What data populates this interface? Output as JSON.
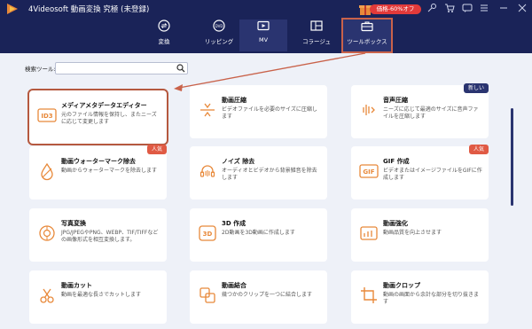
{
  "window": {
    "title": "4Videosoft 動画変換 究極 (未登録)",
    "promo_label": "価格-60%オフ"
  },
  "nav": {
    "tabs": [
      {
        "label": "変換",
        "icon": "convert-icon"
      },
      {
        "label": "リッピング",
        "icon": "dvd-icon"
      },
      {
        "label": "MV",
        "icon": "mv-icon"
      },
      {
        "label": "コラージュ",
        "icon": "collage-icon"
      },
      {
        "label": "ツールボックス",
        "icon": "toolbox-icon"
      }
    ],
    "active_index": 2,
    "highlight_index": 4
  },
  "search": {
    "label": "検索ツール:",
    "placeholder": ""
  },
  "tools": [
    {
      "title": "メディアメタデータエディター",
      "desc": "元のファイル情報を保持し、またニーズに応じて変更します",
      "icon": "id3-icon",
      "badge": ""
    },
    {
      "title": "動画圧縮",
      "desc": "ビデオファイルを必要のサイズに圧縮します",
      "icon": "compress-icon",
      "badge": ""
    },
    {
      "title": "音声圧縮",
      "desc": "ニーズに応じて最適のサイズに音声ファイルを圧縮します",
      "icon": "audio-compress-icon",
      "badge": "新しい"
    },
    {
      "title": "動画ウォーターマーク除去",
      "desc": "動画からウォーターマークを除去します",
      "icon": "watermark-remove-icon",
      "badge": "人気"
    },
    {
      "title": "ノイズ 除去",
      "desc": "オーディオとビデオから背景雑音を除去します",
      "icon": "noise-remove-icon",
      "badge": ""
    },
    {
      "title": "GIF 作成",
      "desc": "ビデオまたはイメージファイルをGIFに作成します",
      "icon": "gif-icon",
      "badge": "人気"
    },
    {
      "title": "写真変換",
      "desc": "JPG/JPEGやPNG、WEBP、TIF/TIFFなどの画像形式を相互変換します。",
      "icon": "photo-convert-icon",
      "badge": ""
    },
    {
      "title": "3D 作成",
      "desc": "2D動画を3D動画に作成します",
      "icon": "3d-icon",
      "badge": ""
    },
    {
      "title": "動画強化",
      "desc": "動画品質を向上させます",
      "icon": "enhance-icon",
      "badge": ""
    },
    {
      "title": "動画カット",
      "desc": "動画を最適な長さでカットします",
      "icon": "cut-icon",
      "badge": ""
    },
    {
      "title": "動画結合",
      "desc": "幾つかのクリップを一つに結合します",
      "icon": "merge-icon",
      "badge": ""
    },
    {
      "title": "動画クロップ",
      "desc": "動画の画面から余計な部分を切り抜きます",
      "icon": "crop-icon",
      "badge": ""
    }
  ],
  "colors": {
    "topbar": "#1a2358",
    "accent": "#2a3470",
    "highlight": "#c9624a",
    "hot_badge": "#e05a44",
    "icon_orange": "#e8893a"
  }
}
